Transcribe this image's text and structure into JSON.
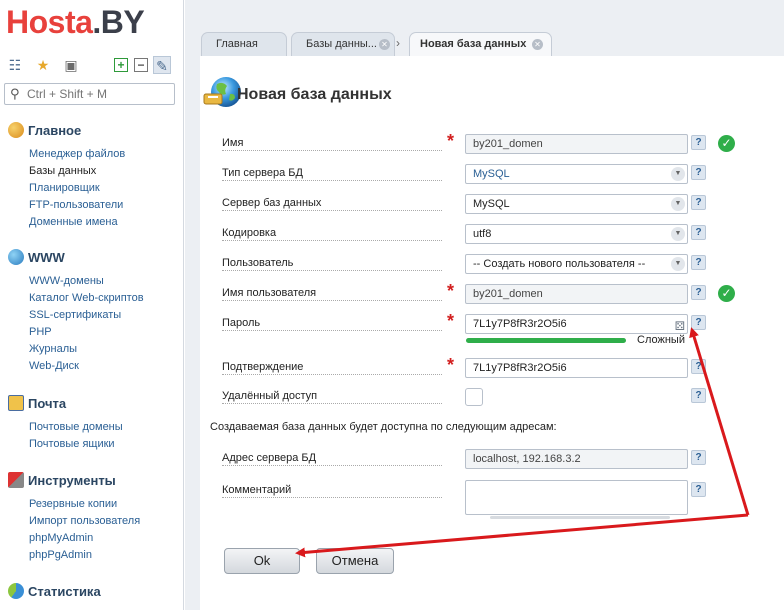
{
  "logo": {
    "part1": "Hosta",
    "part2": ".BY"
  },
  "search": {
    "placeholder": "Ctrl + Shift + M"
  },
  "sidebar": {
    "sections": [
      {
        "title": "Главное",
        "items": [
          "Менеджер файлов",
          "Базы данных",
          "Планировщик",
          "FTP-пользователи",
          "Доменные имена"
        ]
      },
      {
        "title": "WWW",
        "items": [
          "WWW-домены",
          "Каталог Web-скриптов",
          "SSL-сертификаты",
          "PHP",
          "Журналы",
          "Web-Диск"
        ]
      },
      {
        "title": "Почта",
        "items": [
          "Почтовые домены",
          "Почтовые ящики"
        ]
      },
      {
        "title": "Инструменты",
        "items": [
          "Резервные копии",
          "Импорт пользователя",
          "phpMyAdmin",
          "phpPgAdmin"
        ]
      },
      {
        "title": "Статистика",
        "items": []
      }
    ]
  },
  "tabs": [
    {
      "label": "Главная"
    },
    {
      "label": "Базы данны..."
    },
    {
      "label": "Новая база данных"
    }
  ],
  "form": {
    "title": "Новая база данных",
    "fields": {
      "name": {
        "label": "Имя",
        "value": "by201_domen"
      },
      "server_type": {
        "label": "Тип сервера БД",
        "value": "MySQL"
      },
      "db_server": {
        "label": "Сервер баз данных",
        "value": "MySQL"
      },
      "encoding": {
        "label": "Кодировка",
        "value": "utf8"
      },
      "user": {
        "label": "Пользователь",
        "value": "-- Создать нового пользователя --"
      },
      "username": {
        "label": "Имя пользователя",
        "value": "by201_domen"
      },
      "password": {
        "label": "Пароль",
        "value": "7L1y7P8fR3r2O5i6",
        "strength": "Сложный"
      },
      "confirm": {
        "label": "Подтверждение",
        "value": "7L1y7P8fR3r2O5i6"
      },
      "remote": {
        "label": "Удалённый доступ"
      },
      "info": "Создаваемая база данных будет доступна по следующим адресам:",
      "address": {
        "label": "Адрес сервера БД",
        "value": "localhost, 192.168.3.2"
      },
      "comment": {
        "label": "Комментарий",
        "value": ""
      }
    },
    "help_label": "?",
    "ok_label": "Ok",
    "cancel_label": "Отмена"
  },
  "colors": {
    "accent_red": "#e8413c",
    "check_green": "#2fae4a",
    "link_blue": "#2a5f94",
    "arrow_red": "#d9191c"
  }
}
